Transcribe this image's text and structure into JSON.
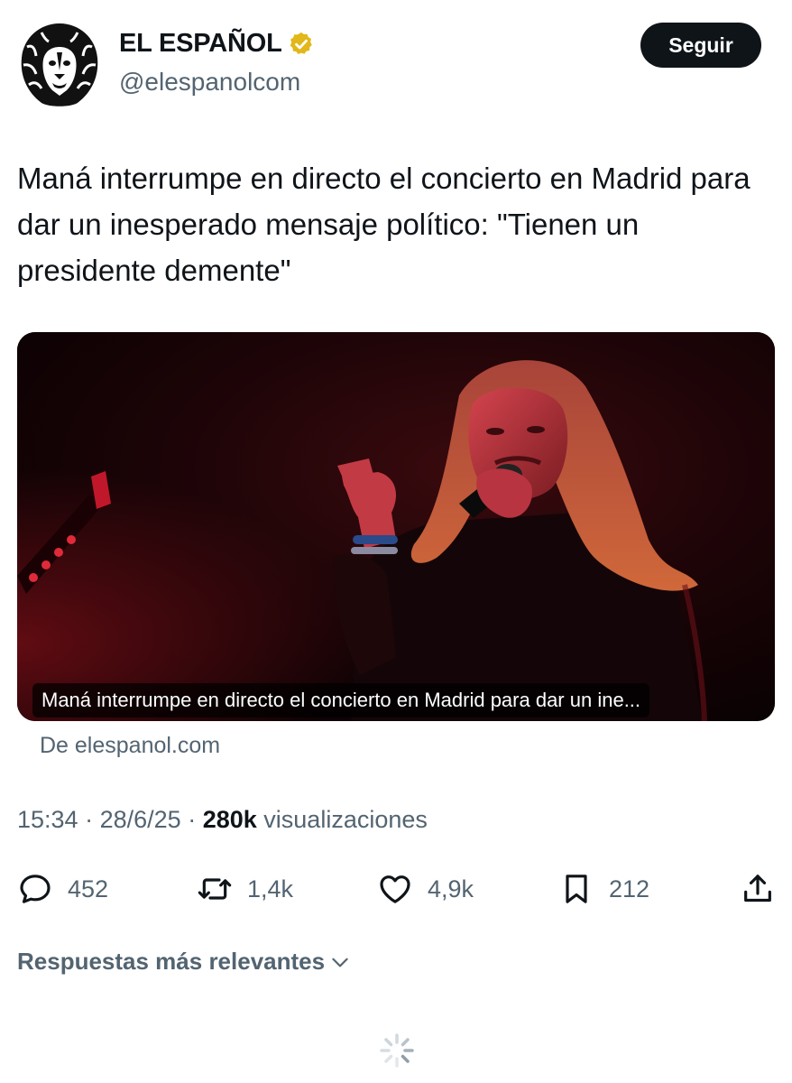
{
  "account": {
    "name": "EL ESPAÑOL",
    "handle": "@elespanolcom",
    "verified_color": "#e2b719",
    "avatar_icon": "lion-logo-icon"
  },
  "follow_button": {
    "label": "Seguir"
  },
  "tweet": {
    "text": "Maná interrumpe en directo el concierto en Madrid para dar un inesperado mensaje político: \"Tienen un presidente demente\""
  },
  "link_card": {
    "caption": "Maná interrumpe en directo el concierto en Madrid para dar un ine...",
    "source": "De elespanol.com",
    "image_icon": "concert-photo"
  },
  "meta": {
    "time": "15:34",
    "date": "28/6/25",
    "views_count": "280k",
    "views_label": "visualizaciones"
  },
  "actions": {
    "replies": "452",
    "retweets": "1,4k",
    "likes": "4,9k",
    "bookmarks": "212"
  },
  "replies_sort": {
    "label": "Respuestas más relevantes"
  },
  "colors": {
    "text_primary": "#0f1419",
    "text_secondary": "#536471",
    "button_bg": "#0f1419",
    "stage_red": "#c0182a"
  }
}
